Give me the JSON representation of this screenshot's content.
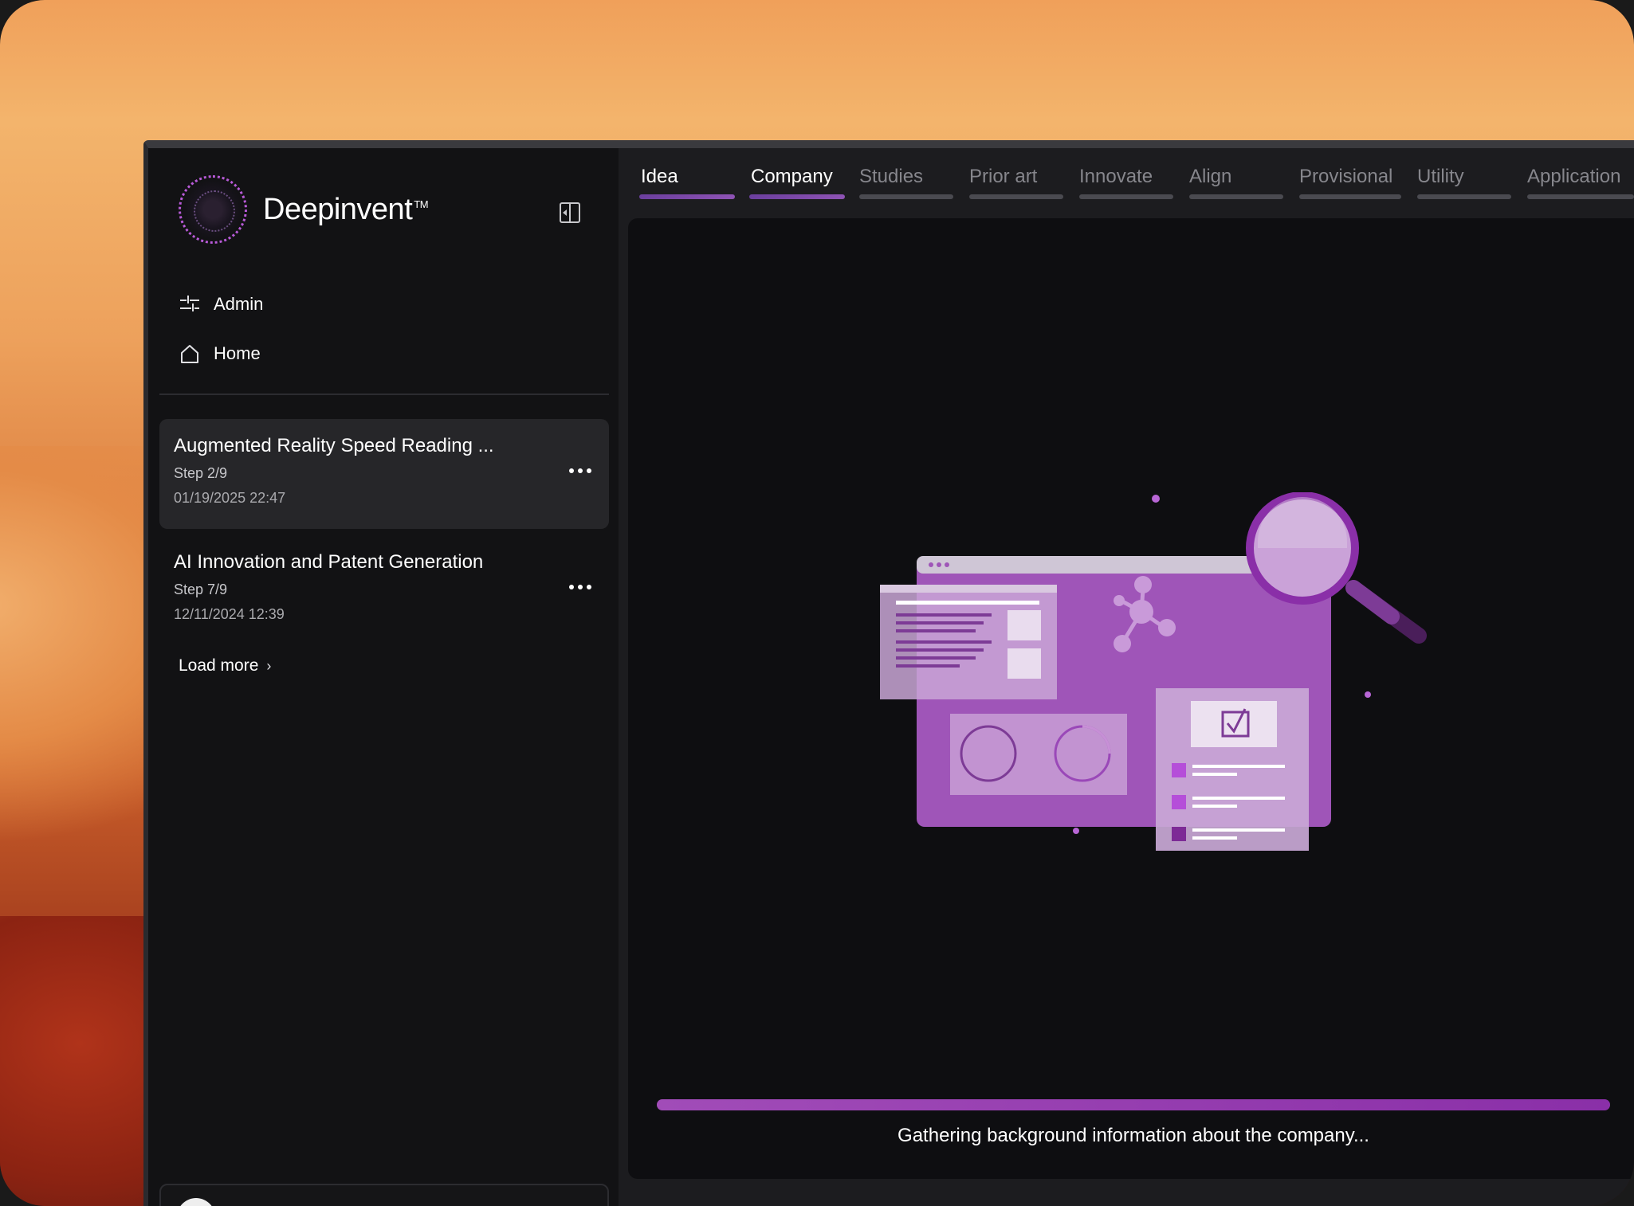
{
  "app": {
    "brand": "Deepinvent",
    "trademark": "TM"
  },
  "nav": {
    "admin": "Admin",
    "home": "Home"
  },
  "projects": [
    {
      "title": "Augmented Reality Speed Reading ...",
      "step": "Step 2/9",
      "date": "01/19/2025 22:47"
    },
    {
      "title": "AI Innovation and Patent Generation",
      "step": "Step 7/9",
      "date": "12/11/2024 12:39"
    }
  ],
  "load_more": "Load more",
  "tabs": [
    {
      "label": "Idea",
      "done": true
    },
    {
      "label": "Company",
      "done": true
    },
    {
      "label": "Studies",
      "done": false
    },
    {
      "label": "Prior art",
      "done": false
    },
    {
      "label": "Innovate",
      "done": false
    },
    {
      "label": "Align",
      "done": false
    },
    {
      "label": "Provisional",
      "done": false
    },
    {
      "label": "Utility",
      "done": false
    },
    {
      "label": "Application",
      "done": false
    }
  ],
  "status": {
    "message": "Gathering background information about the company..."
  },
  "colors": {
    "accent": "#8e53b4",
    "illustration": "#9f55b8"
  },
  "icons": [
    "sliders-icon",
    "home-icon",
    "sidebar-toggle-icon",
    "more-icon",
    "chevron-right-icon"
  ]
}
